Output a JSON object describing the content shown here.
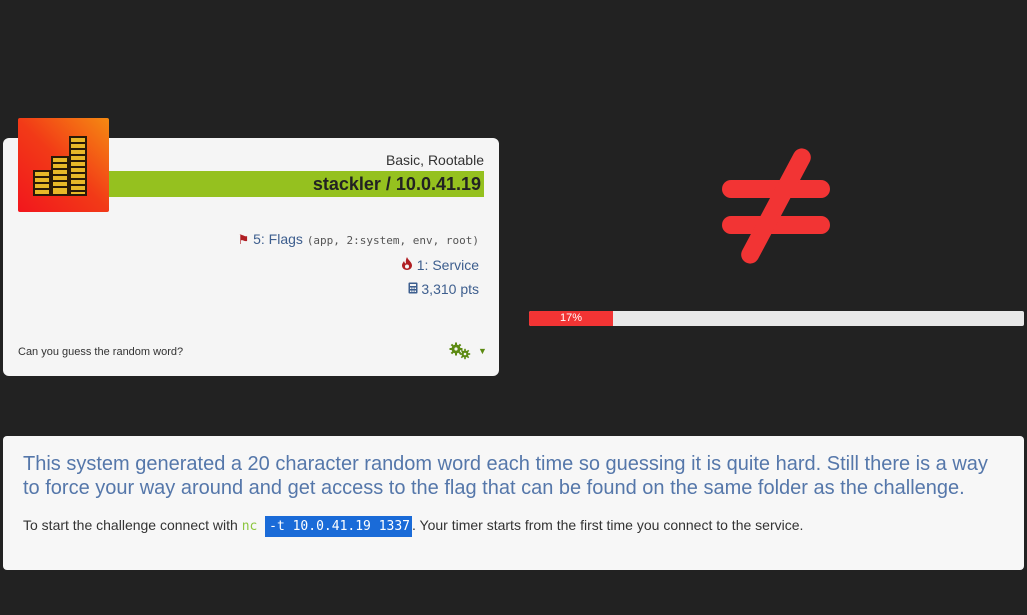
{
  "colors": {
    "background": "#222222",
    "card": "#f5f5f5",
    "title_bar": "#95c11f",
    "accent_red": "#f23434",
    "link_blue": "#3d5e8e",
    "nc_green": "#8cc63f",
    "selection_blue": "#1a6bd8"
  },
  "challenge": {
    "logo_icon": "stacked-coins-icon",
    "tags": "Basic, Rootable",
    "title": "stackler / 10.0.41.19",
    "flags_label": "5: Flags",
    "flags_detail": "(app, 2:system, env, root)",
    "service_label": "1: Service",
    "points_label": "3,310 pts",
    "short_description": "Can you guess the random word?",
    "settings_icon": "gears-icon"
  },
  "status": {
    "symbol_icon": "not-equal-icon",
    "progress_label": "17%",
    "progress_fraction": 0.17
  },
  "details": {
    "description": "This system generated a 20 character random word each time so guessing it is quite hard. Still there is a way to force your way around and get access to the flag that can be found on the same folder as the challenge.",
    "connect_prefix": "To start the challenge connect with ",
    "connect_cmd": "nc",
    "connect_args": "-t 10.0.41.19 1337",
    "connect_suffix": ". Your timer starts from the first time you connect to the service."
  }
}
